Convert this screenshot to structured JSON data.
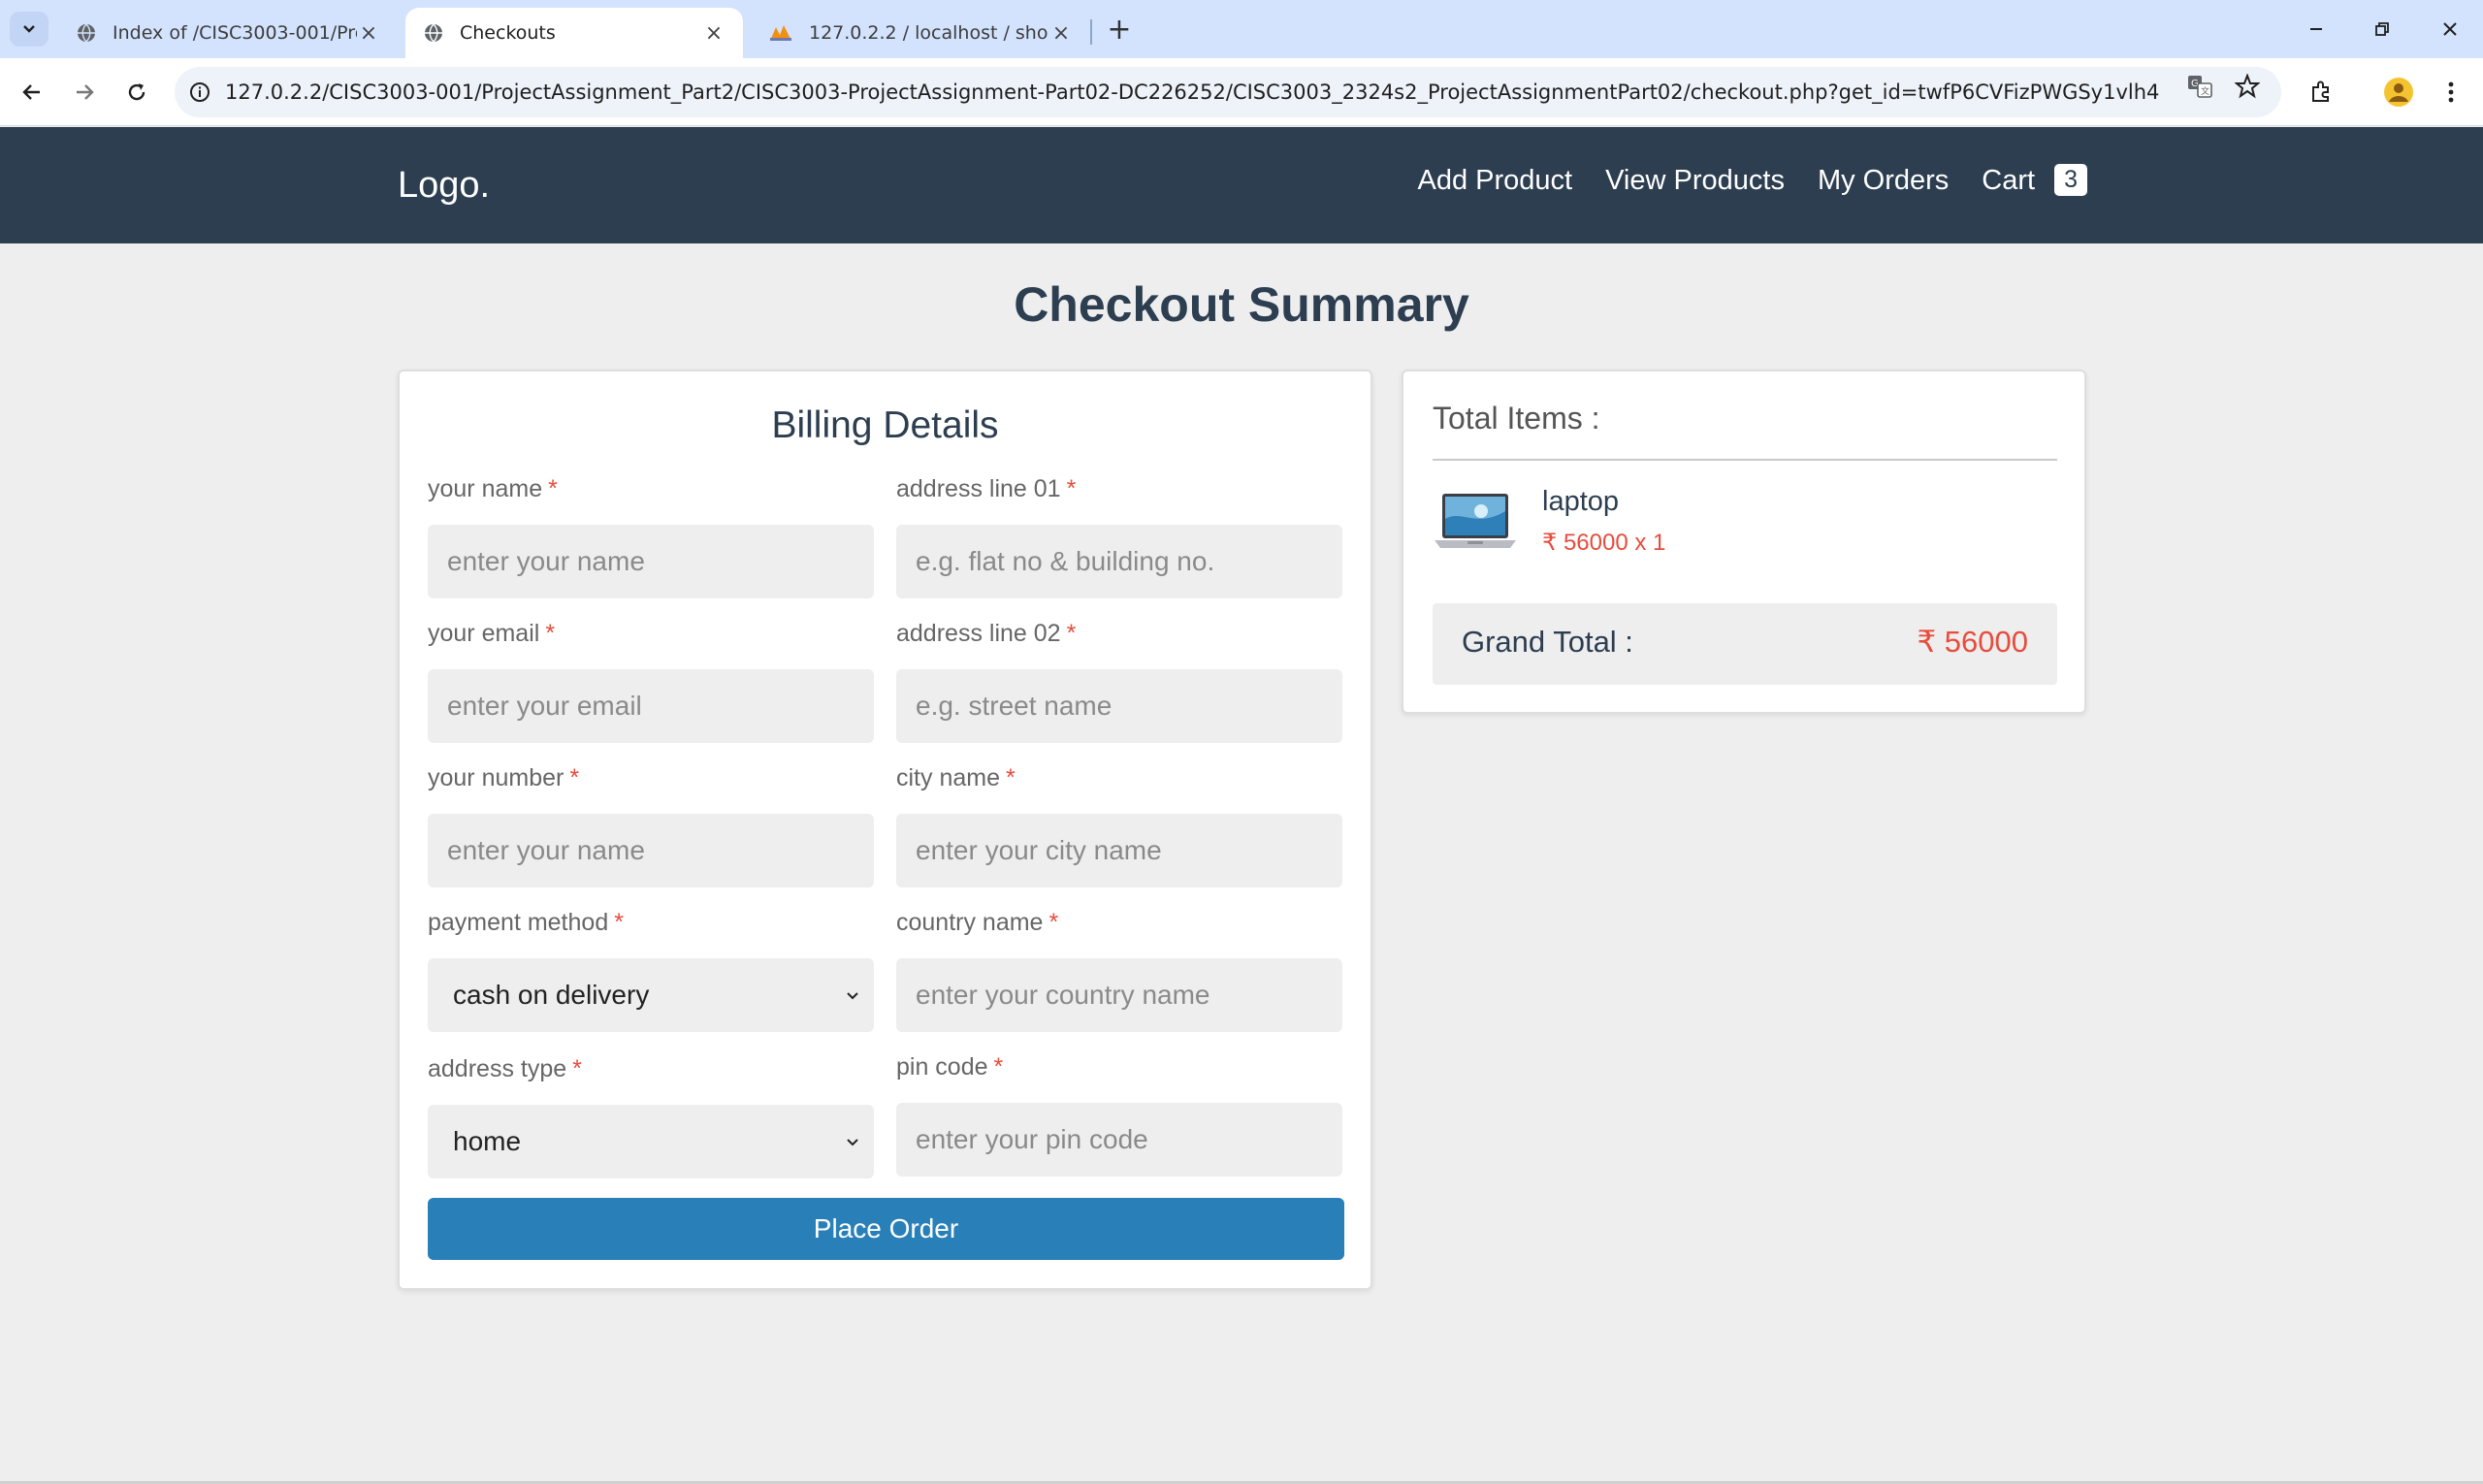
{
  "browser": {
    "tabs": [
      {
        "title": "Index of /CISC3003-001/Proje",
        "active": false,
        "icon": "globe-icon"
      },
      {
        "title": "Checkouts",
        "active": true,
        "icon": "globe-icon"
      },
      {
        "title": "127.0.2.2 / localhost / shop_d",
        "active": false,
        "icon": "phpmyadmin-icon"
      }
    ],
    "url": "127.0.2.2/CISC3003-001/ProjectAssignment_Part2/CISC3003-ProjectAssignment-Part02-DC226252/CISC3003_2324s2_ProjectAssignmentPart02/checkout.php?get_id=twfP6CVFizPWGSy1vlh4"
  },
  "header": {
    "logo": "Logo.",
    "nav": [
      {
        "label": "Add Product"
      },
      {
        "label": "View Products"
      },
      {
        "label": "My Orders"
      },
      {
        "label": "Cart"
      }
    ],
    "cart_count": "3"
  },
  "page": {
    "title": "Checkout Summary"
  },
  "billing": {
    "heading": "Billing Details",
    "required_mark": "*",
    "fields": {
      "name": {
        "label": "your name",
        "placeholder": "enter your name"
      },
      "email": {
        "label": "your email",
        "placeholder": "enter your email"
      },
      "number": {
        "label": "your number",
        "placeholder": "enter your name"
      },
      "payment": {
        "label": "payment method",
        "value": "cash on delivery"
      },
      "address_type": {
        "label": "address type",
        "value": "home"
      },
      "address1": {
        "label": "address line 01",
        "placeholder": "e.g. flat no & building no."
      },
      "address2": {
        "label": "address line 02",
        "placeholder": "e.g. street name"
      },
      "city": {
        "label": "city name",
        "placeholder": "enter your city name"
      },
      "country": {
        "label": "country name",
        "placeholder": "enter your country name"
      },
      "pin": {
        "label": "pin code",
        "placeholder": "enter your pin code"
      }
    },
    "submit_label": "Place Order"
  },
  "summary": {
    "title": "Total Items :",
    "items": [
      {
        "name": "laptop",
        "price": "₹ 56000 x 1"
      }
    ],
    "grand_total_label": "Grand Total :",
    "grand_total_value": "₹ 56000"
  },
  "colors": {
    "header_bg": "#2c3e50",
    "accent_button": "#2980b9",
    "price_red": "#e74c3c",
    "page_bg": "#eeeeee",
    "tabbar_bg": "#d3e3fd"
  }
}
